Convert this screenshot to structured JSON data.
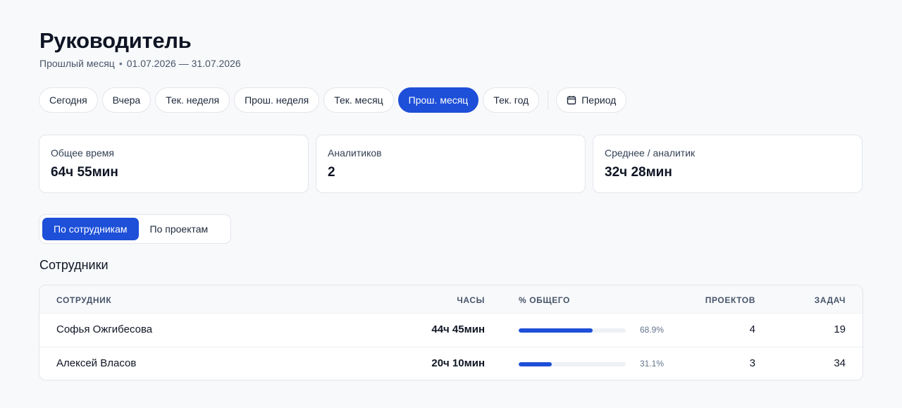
{
  "header": {
    "title": "Руководитель",
    "period_name": "Прошлый месяц",
    "period_range": "01.07.2026 — 31.07.2026"
  },
  "filters": [
    {
      "label": "Сегодня",
      "active": false
    },
    {
      "label": "Вчера",
      "active": false
    },
    {
      "label": "Тек. неделя",
      "active": false
    },
    {
      "label": "Прош. неделя",
      "active": false
    },
    {
      "label": "Тек. месяц",
      "active": false
    },
    {
      "label": "Прош. месяц",
      "active": true
    },
    {
      "label": "Тек. год",
      "active": false
    }
  ],
  "period_button": {
    "label": "Период",
    "icon": "calendar-icon"
  },
  "cards": [
    {
      "label": "Общее время",
      "value": "64ч 55мин"
    },
    {
      "label": "Аналитиков",
      "value": "2"
    },
    {
      "label": "Среднее / аналитик",
      "value": "32ч 28мин"
    }
  ],
  "view_toggle": {
    "by_employees": "По сотрудникам",
    "by_projects": "По проектам",
    "active": "by_employees"
  },
  "section_title": "Сотрудники",
  "table": {
    "columns": {
      "employee": "Сотрудник",
      "hours": "Часы",
      "share": "% общего",
      "projects": "Проектов",
      "tasks": "Задач"
    },
    "rows": [
      {
        "employee": "Софья Ожгибесова",
        "hours": "44ч 45мин",
        "share": 68.9,
        "share_label": "68.9%",
        "projects": "4",
        "tasks": "19"
      },
      {
        "employee": "Алексей Власов",
        "hours": "20ч 10мин",
        "share": 31.1,
        "share_label": "31.1%",
        "projects": "3",
        "tasks": "34"
      }
    ]
  },
  "colors": {
    "accent": "#1d4fd8",
    "border": "#e2e5ea",
    "background": "#f8f9fb"
  }
}
